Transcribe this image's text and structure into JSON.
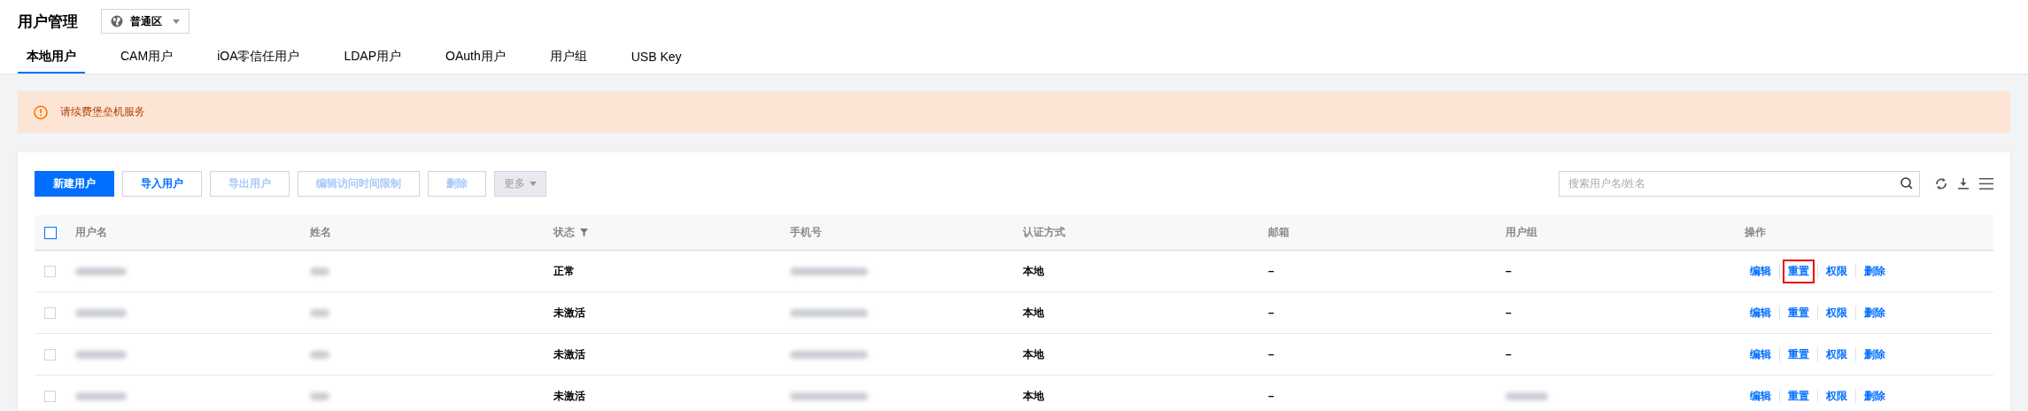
{
  "header": {
    "title": "用户管理",
    "region": "普通区"
  },
  "tabs": [
    {
      "label": "本地用户",
      "selected": true
    },
    {
      "label": "CAM用户",
      "selected": false
    },
    {
      "label": "iOA零信任用户",
      "selected": false
    },
    {
      "label": "LDAP用户",
      "selected": false
    },
    {
      "label": "OAuth用户",
      "selected": false
    },
    {
      "label": "用户组",
      "selected": false
    },
    {
      "label": "USB Key",
      "selected": false
    }
  ],
  "alert": {
    "text": "请续费堡垒机服务"
  },
  "toolbar": {
    "buttons": [
      {
        "label": "新建用户",
        "kind": "primary"
      },
      {
        "label": "导入用户",
        "kind": "default"
      },
      {
        "label": "导出用户",
        "kind": "disabled"
      },
      {
        "label": "编辑访问时间限制",
        "kind": "disabled"
      },
      {
        "label": "删除",
        "kind": "disabled"
      },
      {
        "label": "更多",
        "kind": "dropdown"
      }
    ],
    "search": {
      "placeholder": "搜索用户名/姓名"
    }
  },
  "table": {
    "all_checked": false,
    "columns": [
      {
        "label": "用户名",
        "filterable": false
      },
      {
        "label": "姓名",
        "filterable": false
      },
      {
        "label": "状态",
        "filterable": true
      },
      {
        "label": "手机号",
        "filterable": false
      },
      {
        "label": "认证方式",
        "filterable": false
      },
      {
        "label": "邮箱",
        "filterable": false
      },
      {
        "label": "用户组",
        "filterable": false
      },
      {
        "label": "操作",
        "filterable": false
      }
    ],
    "rows": [
      {
        "selected": false,
        "cells": [
          {
            "kind": "blurred"
          },
          {
            "kind": "blurred"
          },
          {
            "kind": "text",
            "text": "正常"
          },
          {
            "kind": "blurred"
          },
          {
            "kind": "text",
            "text": "本地"
          },
          {
            "kind": "text",
            "text": "–"
          },
          {
            "kind": "text",
            "text": "–"
          }
        ],
        "actions": [
          {
            "label": "编辑",
            "highlighted": false
          },
          {
            "label": "重置",
            "highlighted": true
          },
          {
            "label": "权限",
            "highlighted": false
          },
          {
            "label": "删除",
            "highlighted": false
          }
        ]
      },
      {
        "selected": false,
        "cells": [
          {
            "kind": "blurred"
          },
          {
            "kind": "blurred"
          },
          {
            "kind": "text",
            "text": "未激活"
          },
          {
            "kind": "blurred"
          },
          {
            "kind": "text",
            "text": "本地"
          },
          {
            "kind": "text",
            "text": "–"
          },
          {
            "kind": "text",
            "text": "–"
          }
        ],
        "actions": [
          {
            "label": "编辑",
            "highlighted": false
          },
          {
            "label": "重置",
            "highlighted": false
          },
          {
            "label": "权限",
            "highlighted": false
          },
          {
            "label": "删除",
            "highlighted": false
          }
        ]
      },
      {
        "selected": false,
        "cells": [
          {
            "kind": "blurred"
          },
          {
            "kind": "blurred"
          },
          {
            "kind": "text",
            "text": "未激活"
          },
          {
            "kind": "blurred"
          },
          {
            "kind": "text",
            "text": "本地"
          },
          {
            "kind": "text",
            "text": "–"
          },
          {
            "kind": "text",
            "text": "–"
          }
        ],
        "actions": [
          {
            "label": "编辑",
            "highlighted": false
          },
          {
            "label": "重置",
            "highlighted": false
          },
          {
            "label": "权限",
            "highlighted": false
          },
          {
            "label": "删除",
            "highlighted": false
          }
        ]
      },
      {
        "selected": false,
        "cells": [
          {
            "kind": "blurred"
          },
          {
            "kind": "blurred"
          },
          {
            "kind": "text",
            "text": "未激活"
          },
          {
            "kind": "blurred"
          },
          {
            "kind": "text",
            "text": "本地"
          },
          {
            "kind": "text",
            "text": "–"
          },
          {
            "kind": "blurred"
          }
        ],
        "actions": [
          {
            "label": "编辑",
            "highlighted": false
          },
          {
            "label": "重置",
            "highlighted": false
          },
          {
            "label": "权限",
            "highlighted": false
          },
          {
            "label": "删除",
            "highlighted": false
          }
        ]
      }
    ]
  }
}
